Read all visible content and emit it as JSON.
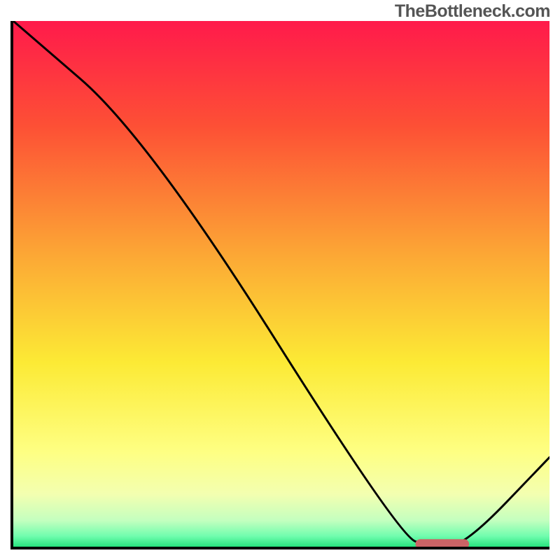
{
  "watermark": "TheBottleneck.com",
  "chart_data": {
    "type": "line",
    "title": "",
    "xlabel": "",
    "ylabel": "",
    "xlim": [
      0,
      100
    ],
    "ylim": [
      0,
      100
    ],
    "series": [
      {
        "name": "bottleneck-curve",
        "x": [
          0,
          25,
          72,
          78,
          84,
          100
        ],
        "y": [
          100,
          78,
          2,
          0,
          0,
          17
        ]
      }
    ],
    "optimal_marker": {
      "x_start": 75,
      "x_end": 85,
      "y": 0.5,
      "color": "#cc6366"
    },
    "gradient_stops": [
      {
        "offset": 0.0,
        "color": "#ff1a4b"
      },
      {
        "offset": 0.2,
        "color": "#fd5035"
      },
      {
        "offset": 0.45,
        "color": "#fca935"
      },
      {
        "offset": 0.65,
        "color": "#fcea35"
      },
      {
        "offset": 0.82,
        "color": "#feff83"
      },
      {
        "offset": 0.9,
        "color": "#f3ffb0"
      },
      {
        "offset": 0.95,
        "color": "#c4ffbf"
      },
      {
        "offset": 0.98,
        "color": "#70fdae"
      },
      {
        "offset": 1.0,
        "color": "#27e47e"
      }
    ]
  }
}
